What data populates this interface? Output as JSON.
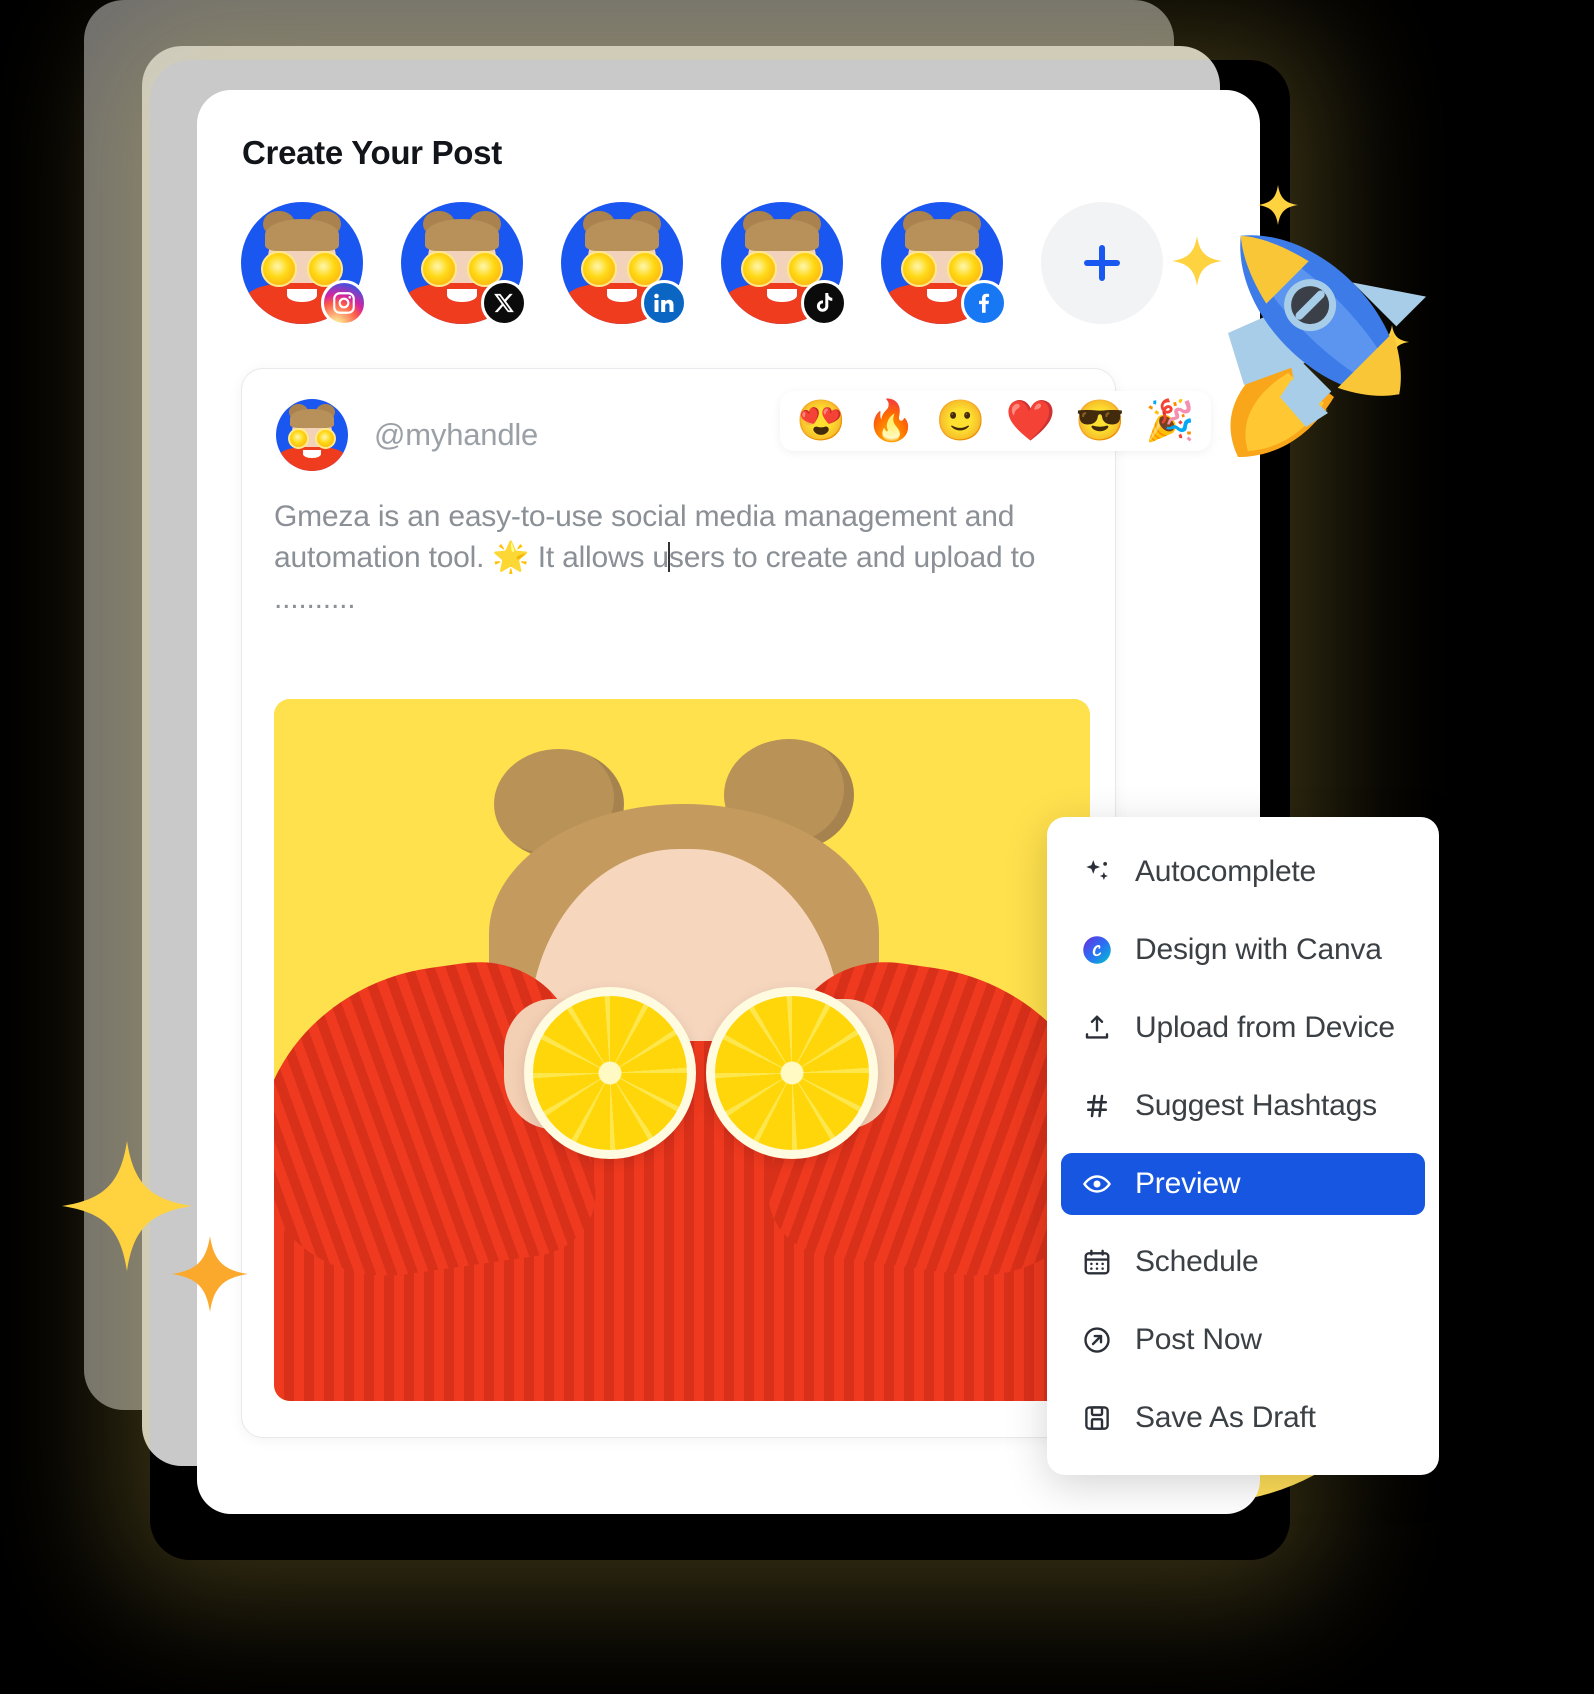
{
  "panel": {
    "title": "Create Your Post"
  },
  "accounts": {
    "add_label": "+",
    "add_icon": "plus-icon",
    "items": [
      {
        "platform": "Instagram",
        "icon": "instagram-icon"
      },
      {
        "platform": "X",
        "icon": "x-icon"
      },
      {
        "platform": "LinkedIn",
        "icon": "linkedin-icon"
      },
      {
        "platform": "TikTok",
        "icon": "tiktok-icon"
      },
      {
        "platform": "Facebook",
        "icon": "facebook-icon"
      }
    ]
  },
  "composer": {
    "handle": "@myhandle",
    "avatar_icon": "user-avatar",
    "post_text_line1": "Gmeza is an easy-to-use social media management and",
    "post_text_line2a": "automation tool. 🌟 It allows u",
    "post_text_line2b": "sers to create and upload to ..........",
    "image_alt": "woman-with-orange-slices-photo",
    "emojis": [
      {
        "name": "heart-eyes-emoji",
        "glyph": "😍"
      },
      {
        "name": "fire-emoji",
        "glyph": "🔥"
      },
      {
        "name": "slight-smile-emoji",
        "glyph": "🙂"
      },
      {
        "name": "heart-emoji",
        "glyph": "❤️"
      },
      {
        "name": "sunglasses-emoji",
        "glyph": "😎"
      },
      {
        "name": "party-popper-emoji",
        "glyph": "🎉"
      }
    ]
  },
  "menu": {
    "items": [
      {
        "label": "Autocomplete",
        "icon": "sparkle-icon",
        "active": false
      },
      {
        "label": "Design with Canva",
        "icon": "canva-icon",
        "active": false
      },
      {
        "label": "Upload from Device",
        "icon": "upload-icon",
        "active": false
      },
      {
        "label": "Suggest Hashtags",
        "icon": "hashtag-icon",
        "active": false
      },
      {
        "label": "Preview",
        "icon": "eye-icon",
        "active": true
      },
      {
        "label": "Schedule",
        "icon": "calendar-icon",
        "active": false
      },
      {
        "label": "Post Now",
        "icon": "send-icon",
        "active": false
      },
      {
        "label": "Save As Draft",
        "icon": "save-icon",
        "active": false
      }
    ]
  },
  "colors": {
    "accent_blue": "#1656e0",
    "brand_yellow": "#FFDE59",
    "background": "#000000",
    "text_muted": "#8b9096",
    "panel_white": "#ffffff"
  },
  "decor": {
    "rocket_icon": "rocket-illustration",
    "sparkle_icon": "sparkle-star",
    "yellow_circle": "yellow-circle-decoration"
  }
}
